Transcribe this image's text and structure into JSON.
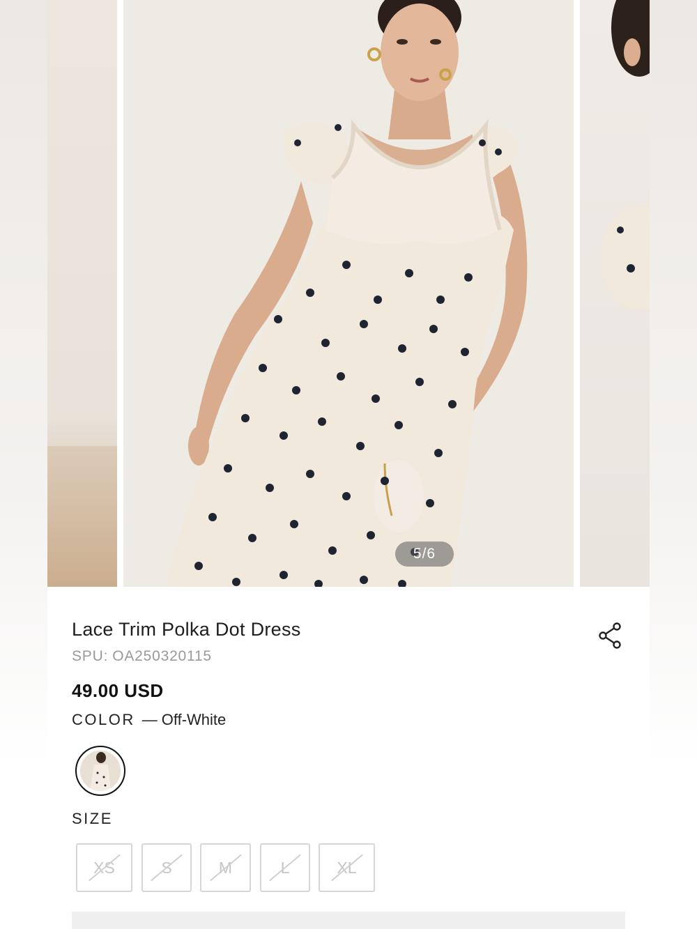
{
  "carousel": {
    "counter": "5/6",
    "current": 5,
    "total": 6
  },
  "product": {
    "title": "Lace Trim Polka Dot Dress",
    "spu_label": "SPU:",
    "spu_value": "OA250320115",
    "price": "49.00 USD",
    "color_label": "COLOR",
    "color_separator": "—",
    "color_value": "Off-White",
    "size_label": "SIZE",
    "sizes": [
      {
        "label": "XS",
        "available": false
      },
      {
        "label": "S",
        "available": false
      },
      {
        "label": "M",
        "available": false
      },
      {
        "label": "L",
        "available": false
      },
      {
        "label": "XL",
        "available": false
      }
    ]
  },
  "icons": {
    "share": "share-icon"
  },
  "colors": {
    "dress": "#f2e9dd",
    "dots": "#1f2433",
    "text_primary": "#1e1e1e",
    "text_muted": "#9a9a9a",
    "size_disabled": "#c6c6c6"
  }
}
